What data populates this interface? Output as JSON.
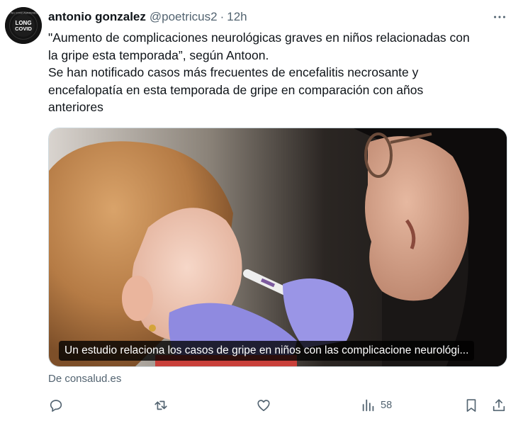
{
  "post": {
    "author_name": "antonio gonzalez",
    "handle": "@poetricus2",
    "separator": "·",
    "time": "12h",
    "avatar_text": {
      "line1": "LONG",
      "line2": "COVID",
      "ring": "LONG COVID AWARENESS"
    },
    "text_lines": [
      "\"Aumento de complicaciones neurológicas graves en niños relacionadas con",
      "la gripe esta temporada”, según Antoon.",
      "Se han notificado casos más frecuentes de encefalitis necrosante y",
      "encefalopatía en esta temporada de gripe en comparación con años",
      "anteriores"
    ],
    "media": {
      "caption": "Un estudio relaciona los casos de gripe en niños con las complicacione neurológi..."
    },
    "source": "De consalud.es",
    "actions": {
      "reply_icon": "reply-icon",
      "repost_icon": "repost-icon",
      "like_icon": "like-icon",
      "views_icon": "views-icon",
      "views_count": "58",
      "bookmark_icon": "bookmark-icon",
      "share_icon": "share-icon"
    },
    "more_icon": "more-icon"
  },
  "colors": {
    "text": "#0f1419",
    "secondary": "#536471",
    "border": "#cfd9de"
  }
}
